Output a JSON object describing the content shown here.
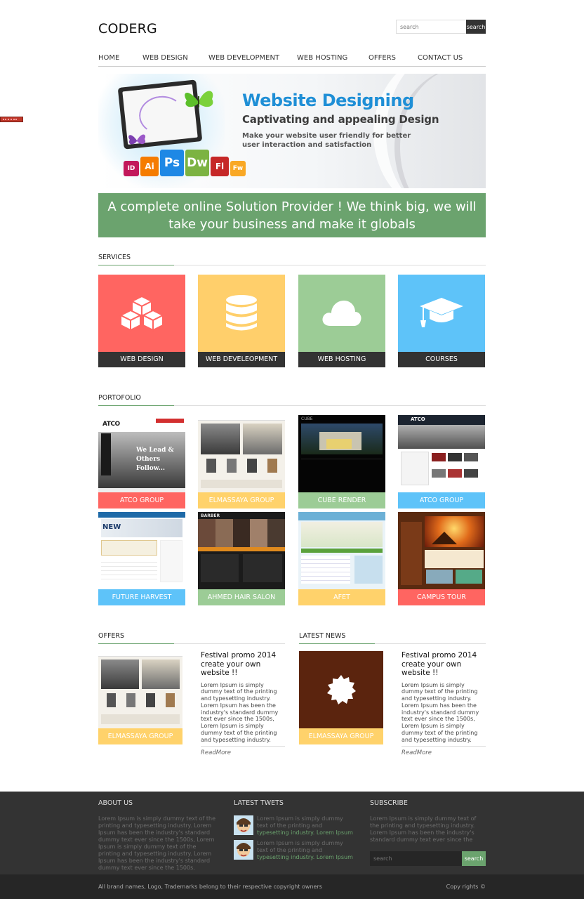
{
  "header": {
    "logo": "CODERG",
    "search_placeholder": "search",
    "search_button": "search"
  },
  "nav": {
    "items": [
      "HOME",
      "WEB DESIGN",
      "WEB DEVELOPMENT",
      "WEB HOSTING",
      "OFFERS",
      "CONTACT US"
    ]
  },
  "banner": {
    "headline": "Website Designing",
    "subheadline": "Captivating and appealing Design",
    "text": "Make your website user friendly for better user interaction and satisfaction",
    "tiles": [
      "ID",
      "Ai",
      "Ps",
      "Dw",
      "Fl",
      "Fw"
    ]
  },
  "tagline": "A complete online Solution Provider ! We think big, we will take your business and make it globals",
  "services": {
    "title": "SERVICES",
    "items": [
      {
        "label": "WEB DESIGN",
        "color": "#ff6561",
        "icon": "cubes-icon"
      },
      {
        "label": "WEB DEVELEOPMENT",
        "color": "#ffcf6b",
        "icon": "database-icon"
      },
      {
        "label": "WEB HOSTING",
        "color": "#9ccc96",
        "icon": "cloud-icon"
      },
      {
        "label": "COURSES",
        "color": "#5ec3f9",
        "icon": "graduation-cap-icon"
      }
    ]
  },
  "portfolio": {
    "title": "PORTOFOLIO",
    "items": [
      {
        "label": "ATCO GROUP",
        "color": "#ff6561"
      },
      {
        "label": "ELMASSAYA GROUP",
        "color": "#ffd26b"
      },
      {
        "label": "CUBE RENDER",
        "color": "#9ccc96"
      },
      {
        "label": "ATCO GROUP",
        "color": "#5ec3f9"
      },
      {
        "label": "FUTURE HARVEST",
        "color": "#5ec3f9"
      },
      {
        "label": "AHMED HAIR SALON",
        "color": "#9ccc96"
      },
      {
        "label": "AFET",
        "color": "#ffd26b"
      },
      {
        "label": "CAMPUS TOUR",
        "color": "#ff6561"
      }
    ],
    "thumb_text": {
      "atco_logo": "ATCO",
      "atco_slogan": "We Lead & Others Follow...",
      "future_harvest": "NEW",
      "cube": "CUBE",
      "barber": "BARBER"
    }
  },
  "offers": {
    "title": "OFFERS",
    "caption": "ELMASSAYA GROUP",
    "headline": "Festival promo 2014 create your own website !!",
    "body": "Lorem Ipsum is simply dummy text of the printing and typesetting industry. Lorem Ipsum has been the industry's standard dummy text ever since the 1500s, Lorem Ipsum is simply dummy text of the printing and typesetting industry. Lorem Ipsum has been the industry's",
    "more": "ReadMore"
  },
  "news": {
    "title": "LATEST NEWS",
    "caption": "ELMASSAYA GROUP",
    "headline": "Festival promo 2014 create your own website !!",
    "body": "Lorem Ipsum is simply dummy text of the printing and typesetting industry. Lorem Ipsum has been the industry's standard dummy text ever since the 1500s, Lorem Ipsum is simply dummy text of the printing and typesetting industry. Lorem Ipsum has been the industry's",
    "more": "ReadMore"
  },
  "footer": {
    "about_title": "ABOUT US",
    "about_text": "Lorem Ipsum is simply dummy text of the printing and typesetting industry. Lorem Ipsum has been the industry's standard dummy text ever since the 1500s, Lorem Ipsum is simply dummy text of the printing and typesetting industry. Lorem Ipsum has been the industry's standard dummy text ever since the 1500s.",
    "tweets_title": "LATEST TWETS",
    "tweets": [
      {
        "text": "Lorem Ipsum is simply dummy text of the printing and",
        "highlight": "typesetting industry. Lorem Ipsum"
      },
      {
        "text": "Lorem Ipsum is simply dummy text of the printing and",
        "highlight": "typesetting industry. Lorem Ipsum"
      }
    ],
    "subscribe_title": "SUBSCRIBE",
    "subscribe_text": "Lorem Ipsum is simply dummy text of the printing and typesetting industry. Lorem Ipsum has been the industry's standard dummy text ever since the",
    "subscribe_placeholder": "search",
    "subscribe_button": "search"
  },
  "bottom": {
    "left": "All brand names, Logo, Trademarks belong to their respective copyright owners",
    "right": "Copy rights ©"
  }
}
